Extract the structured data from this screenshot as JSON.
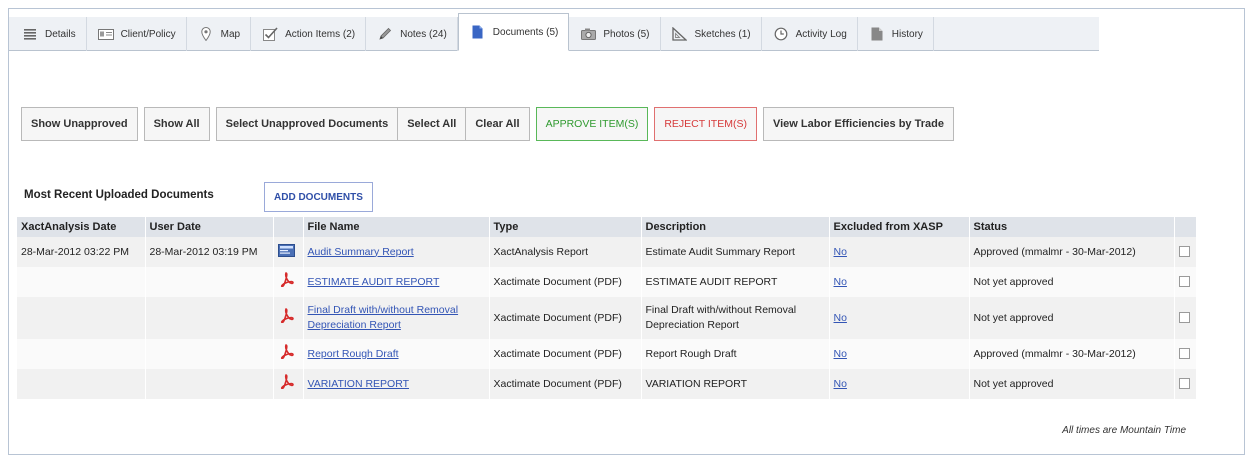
{
  "tabs": [
    {
      "label": "Details",
      "icon": "list-icon"
    },
    {
      "label": "Client/Policy",
      "icon": "id-card-icon"
    },
    {
      "label": "Map",
      "icon": "map-pin-icon"
    },
    {
      "label": "Action Items (2)",
      "icon": "checkmark-icon"
    },
    {
      "label": "Notes (24)",
      "icon": "pencil-icon"
    },
    {
      "label": "Documents (5)",
      "icon": "document-icon",
      "active": true
    },
    {
      "label": "Photos (5)",
      "icon": "camera-icon"
    },
    {
      "label": "Sketches (1)",
      "icon": "triangle-ruler-icon"
    },
    {
      "label": "Activity Log",
      "icon": "clock-icon"
    },
    {
      "label": "History",
      "icon": "archive-icon"
    }
  ],
  "toolbar": {
    "show_unapproved": "Show Unapproved",
    "show_all": "Show All",
    "select_unapproved": "Select Unapproved Documents",
    "select_all": "Select All",
    "clear_all": "Clear All",
    "approve": "APPROVE ITEM(S)",
    "reject": "REJECT ITEM(S)",
    "labor": "View Labor Efficiencies by Trade"
  },
  "section": {
    "title": "Most Recent Uploaded Documents",
    "add_button": "ADD DOCUMENTS"
  },
  "table": {
    "headers": {
      "xact_date": "XactAnalysis Date",
      "user_date": "User Date",
      "file_name": "File Name",
      "type": "Type",
      "description": "Description",
      "excluded": "Excluded from XASP",
      "status": "Status"
    },
    "rows": [
      {
        "xact_date": "28-Mar-2012 03:22 PM",
        "user_date": "28-Mar-2012 03:19 PM",
        "icon": "report-icon",
        "file_name": "Audit Summary Report",
        "type": "XactAnalysis Report",
        "description": "Estimate Audit Summary Report",
        "excluded": "No",
        "status": "Approved (mmalmr - 30-Mar-2012)",
        "approved": true
      },
      {
        "xact_date": "",
        "user_date": "",
        "icon": "pdf-icon",
        "file_name": "ESTIMATE AUDIT REPORT",
        "type": "Xactimate Document (PDF)",
        "description": "ESTIMATE AUDIT REPORT",
        "excluded": "No",
        "status": "Not yet approved",
        "approved": false
      },
      {
        "xact_date": "",
        "user_date": "",
        "icon": "pdf-icon",
        "file_name": "Final Draft with/without Removal Depreciation Report",
        "type": "Xactimate Document (PDF)",
        "description": "Final Draft with/without Removal Depreciation Report",
        "excluded": "No",
        "status": "Not yet approved",
        "approved": false
      },
      {
        "xact_date": "",
        "user_date": "",
        "icon": "pdf-icon",
        "file_name": "Report Rough Draft",
        "type": "Xactimate Document (PDF)",
        "description": "Report Rough Draft",
        "excluded": "No",
        "status": "Approved (mmalmr - 30-Mar-2012)",
        "approved": true
      },
      {
        "xact_date": "",
        "user_date": "",
        "icon": "pdf-icon",
        "file_name": "VARIATION REPORT",
        "type": "Xactimate Document (PDF)",
        "description": "VARIATION REPORT",
        "excluded": "No",
        "status": "Not yet approved",
        "approved": false
      }
    ]
  },
  "footnote": "All times are Mountain Time",
  "colors": {
    "approved": "#2f9a2f",
    "reject": "#d63a3a",
    "link": "#3355b5",
    "pdf": "#d62b2b"
  }
}
